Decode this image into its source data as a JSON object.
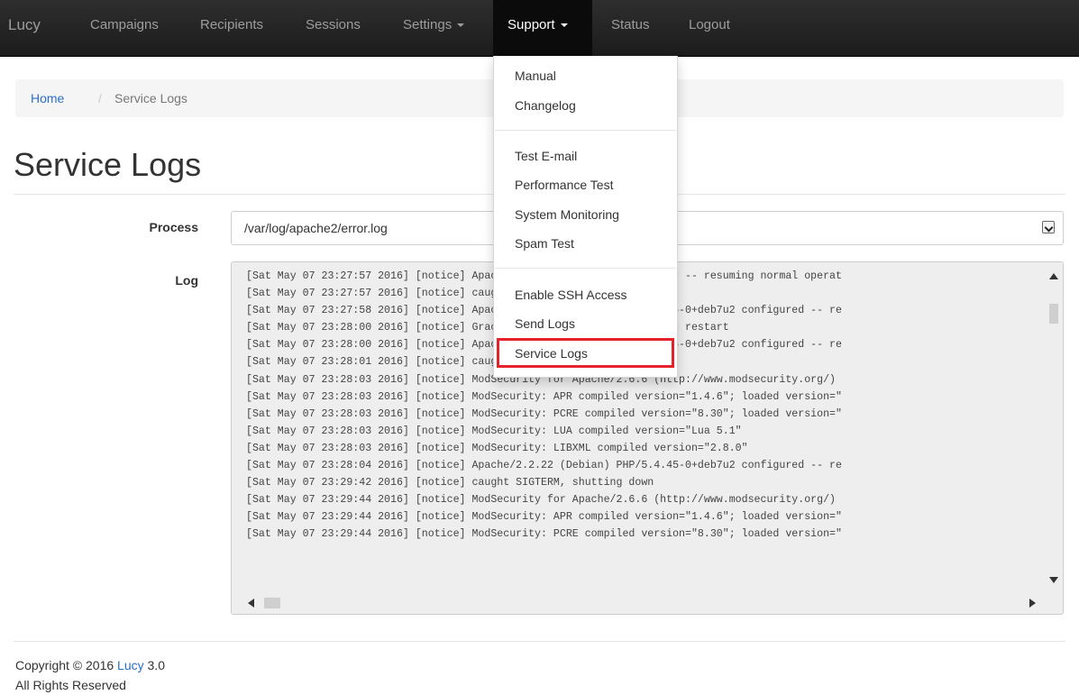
{
  "navbar": {
    "brand": "Lucy",
    "items": [
      {
        "label": "Campaigns",
        "caret": false
      },
      {
        "label": "Recipients",
        "caret": false
      },
      {
        "label": "Sessions",
        "caret": false
      },
      {
        "label": "Settings",
        "caret": true
      },
      {
        "label": "Support",
        "caret": true,
        "active": true
      },
      {
        "label": "Status",
        "caret": false
      },
      {
        "label": "Logout",
        "caret": false
      }
    ]
  },
  "breadcrumb": {
    "home": "Home",
    "separator": "/",
    "current": "Service Logs"
  },
  "page": {
    "title": "Service Logs"
  },
  "form": {
    "process_label": "Process",
    "process_value": "/var/log/apache2/error.log",
    "log_label": "Log"
  },
  "log_lines": [
    "[Sat May 07 23:27:57 2016] [notice] Apache/2.2.22 (Debian) configured -- resuming normal operat",
    "[Sat May 07 23:27:57 2016] [notice] caught SIGTERM, shutting down",
    "[Sat May 07 23:27:58 2016] [notice] Apache/2.2.22 (Debian) PHP/5.4.45-0+deb7u2 configured -- re",
    "[Sat May 07 23:28:00 2016] [notice] Graceful restart requested, doing restart",
    "[Sat May 07 23:28:00 2016] [notice] Apache/2.2.22 (Debian) PHP/5.4.45-0+deb7u2 configured -- re",
    "[Sat May 07 23:28:01 2016] [notice] caught SIGTERM, shutting down",
    "[Sat May 07 23:28:03 2016] [notice] ModSecurity for Apache/2.6.6 (http://www.modsecurity.org/)",
    "[Sat May 07 23:28:03 2016] [notice] ModSecurity: APR compiled version=\"1.4.6\"; loaded version=\"",
    "[Sat May 07 23:28:03 2016] [notice] ModSecurity: PCRE compiled version=\"8.30\"; loaded version=\"",
    "[Sat May 07 23:28:03 2016] [notice] ModSecurity: LUA compiled version=\"Lua 5.1\"",
    "[Sat May 07 23:28:03 2016] [notice] ModSecurity: LIBXML compiled version=\"2.8.0\"",
    "[Sat May 07 23:28:04 2016] [notice] Apache/2.2.22 (Debian) PHP/5.4.45-0+deb7u2 configured -- re",
    "[Sat May 07 23:29:42 2016] [notice] caught SIGTERM, shutting down",
    "[Sat May 07 23:29:44 2016] [notice] ModSecurity for Apache/2.6.6 (http://www.modsecurity.org/)",
    "[Sat May 07 23:29:44 2016] [notice] ModSecurity: APR compiled version=\"1.4.6\"; loaded version=\"",
    "[Sat May 07 23:29:44 2016] [notice] ModSecurity: PCRE compiled version=\"8.30\"; loaded version=\""
  ],
  "support_menu": {
    "group1": [
      "Manual",
      "Changelog"
    ],
    "group2": [
      "Test E-mail",
      "Performance Test",
      "System Monitoring",
      "Spam Test"
    ],
    "group3": [
      "Enable SSH Access",
      "Send Logs",
      "Service Logs"
    ],
    "highlighted": "Service Logs"
  },
  "footer": {
    "copyright_prefix": "Copyright © 2016",
    "brand": "Lucy",
    "version": "3.0",
    "rights": "All Rights Reserved"
  },
  "colors": {
    "navbar_bg": "#222222",
    "link": "#2a6fc9",
    "highlight": "#e52129"
  }
}
